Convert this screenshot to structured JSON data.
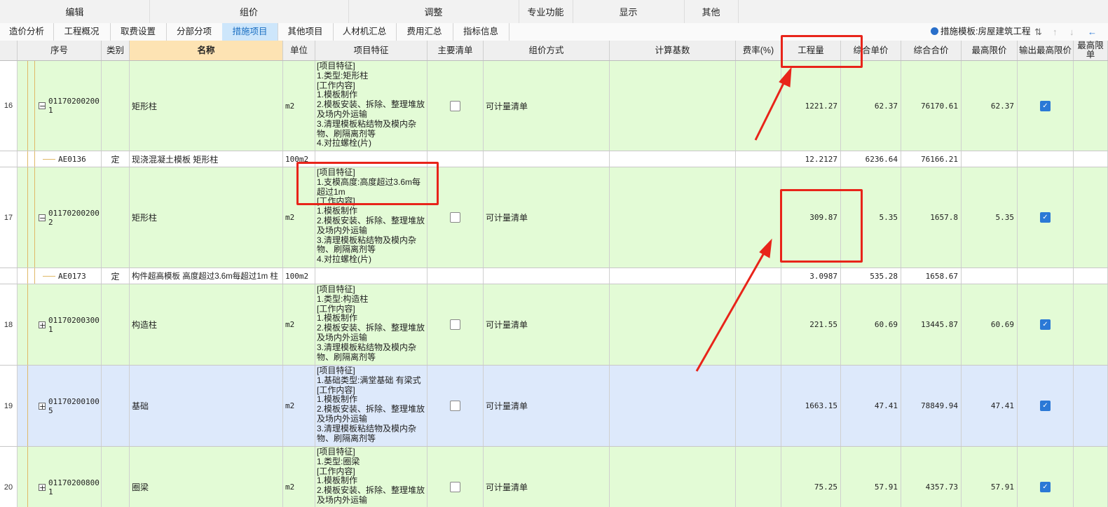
{
  "menu": [
    "编辑",
    "组价",
    "调整",
    "专业功能",
    "显示",
    "其他"
  ],
  "tabs": [
    "造价分析",
    "工程概况",
    "取费设置",
    "分部分项",
    "措施项目",
    "其他项目",
    "人材机汇总",
    "费用汇总",
    "指标信息"
  ],
  "active_tab": "措施项目",
  "template_label": "措施模板:房屋建筑工程",
  "columns": [
    "序号",
    "类别",
    "名称",
    "单位",
    "项目特征",
    "主要清单",
    "组价方式",
    "计算基数",
    "费率(%)",
    "工程量",
    "综合单价",
    "综合合价",
    "最高限价",
    "输出最高限价",
    "最高限\n单"
  ],
  "rows": [
    {
      "seq": "16",
      "code1": "01170200200",
      "code2": "1",
      "expander": "−",
      "name": "矩形柱",
      "unit": "m2",
      "feat": "[项目特征]\n1.类型:矩形柱\n[工作内容]\n1.模板制作\n2.模板安装、拆除、整理堆放\n及场内外运输\n3.清理模板粘结物及模内杂\n物、刷隔离剂等\n4.对拉螺栓(片)",
      "method": "可计量清单",
      "qty": "1221.27",
      "uprice": "62.37",
      "total": "76170.61",
      "maxp": "62.37"
    },
    {
      "code": "AE0136",
      "cat": "定",
      "name": "现浇混凝土模板 矩形柱",
      "unit": "100m2",
      "qty": "12.2127",
      "uprice": "6236.64",
      "total": "76166.21"
    },
    {
      "seq": "17",
      "code1": "01170200200",
      "code2": "2",
      "expander": "−",
      "name": "矩形柱",
      "unit": "m2",
      "feat": "[项目特征]\n1.支模高度:高度超过3.6m每\n超过1m\n[工作内容]\n1.模板制作\n2.模板安装、拆除、整理堆放\n及场内外运输\n3.清理模板粘结物及模内杂\n物、刷隔离剂等\n4.对拉螺栓(片)",
      "method": "可计量清单",
      "qty": "309.87",
      "uprice": "5.35",
      "total": "1657.8",
      "maxp": "5.35"
    },
    {
      "code": "AE0173",
      "cat": "定",
      "name": "构件超高模板 高度超过3.6m每超过1m 柱",
      "unit": "100m2",
      "qty": "3.0987",
      "uprice": "535.28",
      "total": "1658.67"
    },
    {
      "seq": "18",
      "code1": "01170200300",
      "code2": "1",
      "expander": "+",
      "name": "构造柱",
      "unit": "m2",
      "feat": "[项目特征]\n1.类型:构造柱\n[工作内容]\n1.模板制作\n2.模板安装、拆除、整理堆放\n及场内外运输\n3.清理模板粘结物及模内杂\n物、刷隔离剂等",
      "method": "可计量清单",
      "qty": "221.55",
      "uprice": "60.69",
      "total": "13445.87",
      "maxp": "60.69"
    },
    {
      "seq": "19",
      "code1": "01170200100",
      "code2": "5",
      "expander": "+",
      "name": "基础",
      "unit": "m2",
      "feat": "[项目特征]\n1.基础类型:满堂基础 有梁式\n[工作内容]\n1.模板制作\n2.模板安装、拆除、整理堆放\n及场内外运输\n3.清理模板粘结物及模内杂\n物、刷隔离剂等",
      "method": "可计量清单",
      "qty": "1663.15",
      "uprice": "47.41",
      "total": "78849.94",
      "maxp": "47.41"
    },
    {
      "seq": "20",
      "code1": "01170200800",
      "code2": "1",
      "expander": "+",
      "name": "圈梁",
      "unit": "m2",
      "feat": "[项目特征]\n1.类型:圈梁\n[工作内容]\n1.模板制作\n2.模板安装、拆除、整理堆放\n及场内外运输",
      "method": "可计量清单",
      "qty": "75.25",
      "uprice": "57.91",
      "total": "4357.73",
      "maxp": "57.91"
    }
  ],
  "colors": {
    "green_row": "#e3fbd6",
    "blue_row": "#dde9fb",
    "annotation": "#e8241a",
    "active_tab": "#cde6fb"
  }
}
